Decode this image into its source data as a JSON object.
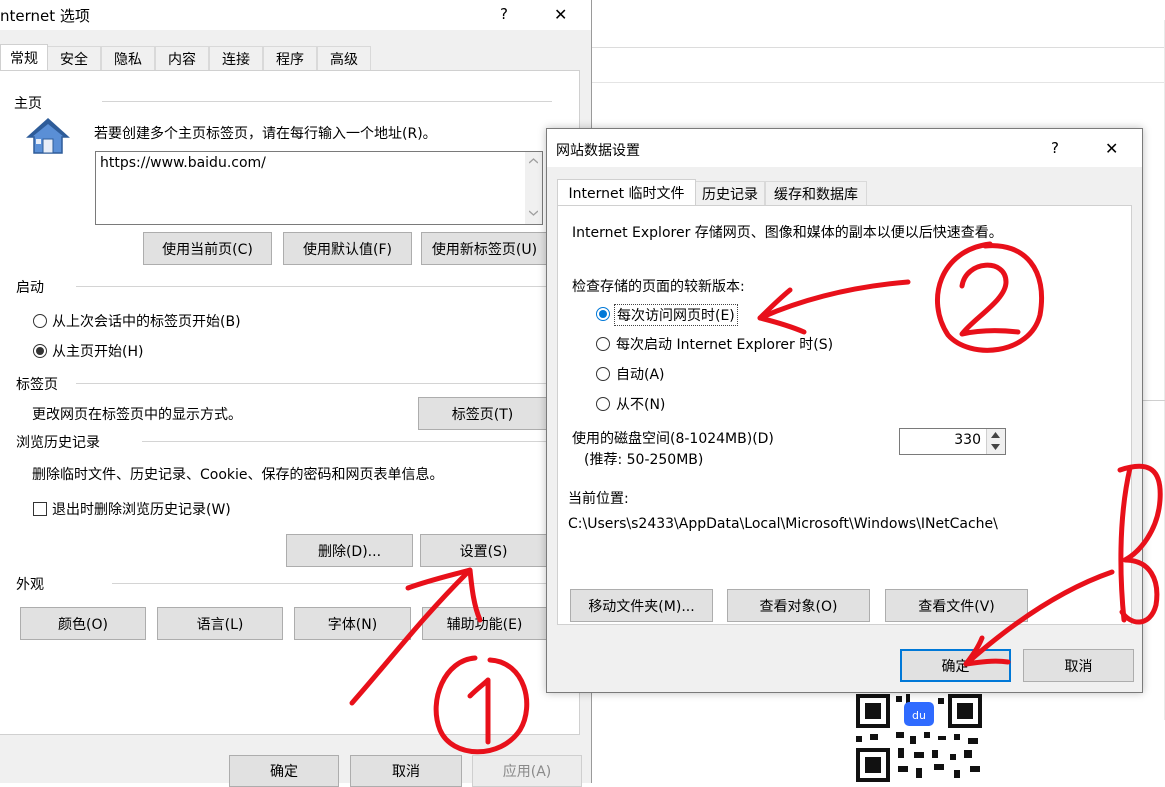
{
  "bg_window": {},
  "options_dialog": {
    "title": "nternet 选项",
    "help": "?",
    "close": "✕",
    "tabs": [
      "常规",
      "安全",
      "隐私",
      "内容",
      "连接",
      "程序",
      "高级"
    ],
    "homepage": {
      "section": "主页",
      "instruction": "若要创建多个主页标签页，请在每行输入一个地址(R)。",
      "url": "https://www.baidu.com/",
      "buttons": [
        "使用当前页(C)",
        "使用默认值(F)",
        "使用新标签页(U)"
      ]
    },
    "startup": {
      "section": "启动",
      "options": [
        "从上次会话中的标签页开始(B)",
        "从主页开始(H)"
      ],
      "selected_index": 1
    },
    "tabs_section": {
      "section": "标签页",
      "description": "更改网页在标签页中的显示方式。",
      "button": "标签页(T)"
    },
    "history": {
      "section": "浏览历史记录",
      "description": "删除临时文件、历史记录、Cookie、保存的密码和网页表单信息。",
      "checkbox": "退出时删除浏览历史记录(W)",
      "checked": false,
      "delete_button": "删除(D)...",
      "settings_button": "设置(S)"
    },
    "appearance": {
      "section": "外观",
      "buttons": [
        "颜色(O)",
        "语言(L)",
        "字体(N)",
        "辅助功能(E)"
      ]
    },
    "footer": {
      "ok": "确定",
      "cancel": "取消",
      "apply": "应用(A)"
    }
  },
  "site_dialog": {
    "title": "网站数据设置",
    "help": "?",
    "close": "✕",
    "tabs": [
      "Internet 临时文件",
      "历史记录",
      "缓存和数据库"
    ],
    "description": "Internet Explorer 存储网页、图像和媒体的副本以便以后快速查看。",
    "check_label": "检查存储的页面的较新版本:",
    "radio_options": [
      "每次访问网页时(E)",
      "每次启动 Internet Explorer 时(S)",
      "自动(A)",
      "从不(N)"
    ],
    "selected_index": 0,
    "disk_label": "使用的磁盘空间(8-1024MB)(D)",
    "disk_hint": "(推荐: 50-250MB)",
    "disk_value": "330",
    "location_label": "当前位置:",
    "location_path": "C:\\Users\\s2433\\AppData\\Local\\Microsoft\\Windows\\INetCache\\",
    "buttons": [
      "移动文件夹(M)...",
      "查看对象(O)",
      "查看文件(V)"
    ],
    "ok": "确定",
    "cancel": "取消"
  },
  "annotations": [
    "①",
    "②",
    "③"
  ],
  "colors": {
    "annotation_red": "#e8101a",
    "accent_blue": "#0078d7"
  }
}
